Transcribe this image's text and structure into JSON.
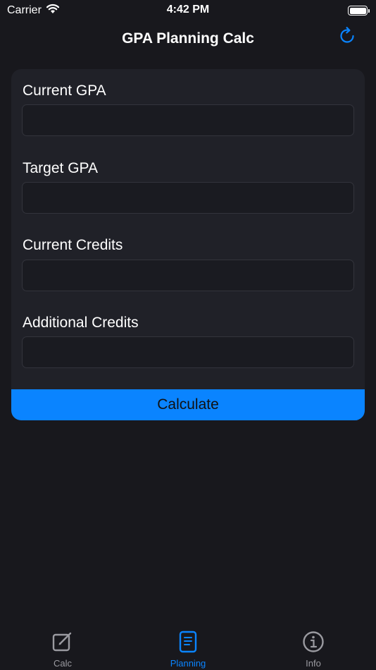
{
  "status_bar": {
    "carrier": "Carrier",
    "time": "4:42 PM"
  },
  "nav": {
    "title": "GPA Planning Calc"
  },
  "form": {
    "fields": [
      {
        "label": "Current GPA",
        "value": ""
      },
      {
        "label": "Target GPA",
        "value": ""
      },
      {
        "label": "Current Credits",
        "value": ""
      },
      {
        "label": "Additional Credits",
        "value": ""
      }
    ],
    "calculate_label": "Calculate"
  },
  "tabs": [
    {
      "label": "Calc",
      "icon": "edit-icon",
      "active": false
    },
    {
      "label": "Planning",
      "icon": "document-icon",
      "active": true
    },
    {
      "label": "Info",
      "icon": "info-icon",
      "active": false
    }
  ],
  "colors": {
    "background": "#18181d",
    "card": "#202128",
    "accent": "#0a84ff",
    "inactive_tab": "#9a9aa0"
  }
}
